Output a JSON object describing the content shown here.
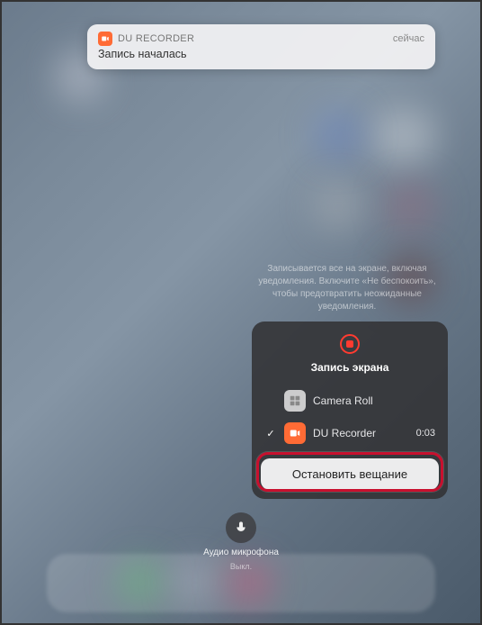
{
  "notification": {
    "app_name": "DU RECORDER",
    "timestamp": "сейчас",
    "message": "Запись началась"
  },
  "hint": "Записывается все на экране, включая уведомления. Включите «Не беспокоить», чтобы предотвратить неожиданные уведомления.",
  "record_panel": {
    "title": "Запись экрана",
    "targets": [
      {
        "label": "Camera Roll",
        "selected": false,
        "time": ""
      },
      {
        "label": "DU Recorder",
        "selected": true,
        "time": "0:03"
      }
    ],
    "stop_label": "Остановить вещание"
  },
  "mic": {
    "label": "Аудио микрофона",
    "status": "Выкл."
  },
  "colors": {
    "accent_orange": "#ff6b35",
    "record_red": "#ff3b30",
    "highlight": "#c8102e"
  }
}
